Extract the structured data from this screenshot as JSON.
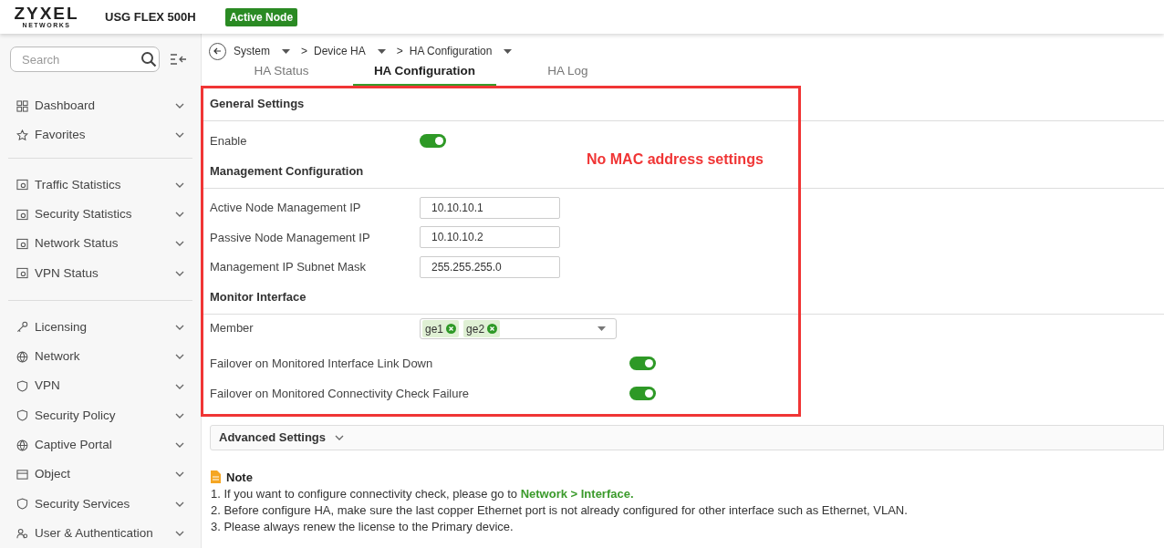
{
  "header": {
    "brand": "ZYXEL",
    "brand_sub": "NETWORKS",
    "model": "USG FLEX 500H",
    "badge": "Active Node"
  },
  "sidebar": {
    "search": {
      "placeholder": "Search"
    },
    "groups": [
      [
        {
          "label": "Dashboard"
        },
        {
          "label": "Favorites"
        }
      ],
      [
        {
          "label": "Traffic Statistics"
        },
        {
          "label": "Security Statistics"
        },
        {
          "label": "Network Status"
        },
        {
          "label": "VPN Status"
        }
      ],
      [
        {
          "label": "Licensing"
        },
        {
          "label": "Network"
        },
        {
          "label": "VPN"
        },
        {
          "label": "Security Policy"
        },
        {
          "label": "Captive Portal"
        },
        {
          "label": "Object"
        },
        {
          "label": "Security Services"
        },
        {
          "label": "User & Authentication"
        }
      ]
    ]
  },
  "breadcrumb": [
    {
      "label": "System"
    },
    {
      "separator": ">",
      "label": "Device HA"
    },
    {
      "separator": ">",
      "label": "HA Configuration"
    }
  ],
  "tabs": [
    {
      "label": "HA Status",
      "selected": false
    },
    {
      "label": "HA Configuration",
      "selected": true
    },
    {
      "label": "HA Log",
      "selected": false
    }
  ],
  "sections": [
    {
      "title": "General Settings",
      "rows": [
        {
          "kind": "toggle",
          "label": "Enable",
          "on": true
        }
      ]
    },
    {
      "title": "Management Configuration",
      "rows": [
        {
          "kind": "input",
          "label": "Active Node Management IP",
          "value": "10.10.10.1"
        },
        {
          "kind": "input",
          "label": "Passive Node Management IP",
          "value": "10.10.10.2"
        },
        {
          "kind": "input",
          "label": "Management IP Subnet Mask",
          "value": "255.255.255.0"
        }
      ]
    },
    {
      "title": "Monitor Interface",
      "rows": [
        {
          "kind": "tags",
          "label": "Member",
          "tags": [
            "ge1",
            "ge2"
          ]
        },
        {
          "kind": "toggle2",
          "label": "Failover on Monitored Interface Link Down",
          "on": true
        },
        {
          "kind": "toggle2",
          "label": "Failover on Monitored Connectivity Check Failure",
          "on": true
        }
      ]
    }
  ],
  "annotation": "No MAC address settings",
  "advanced": {
    "label": "Advanced Settings",
    "expanded": false
  },
  "note": {
    "title": "Note",
    "items": [
      "1. If you want to configure connectivity check, please go to **Network > Interface.**",
      "2. Before configure HA, make sure the last copper Ethernet port is not already configured for other interface such as Ethernet, VLAN.",
      "3. Please always renew the license to the Primary device."
    ]
  }
}
